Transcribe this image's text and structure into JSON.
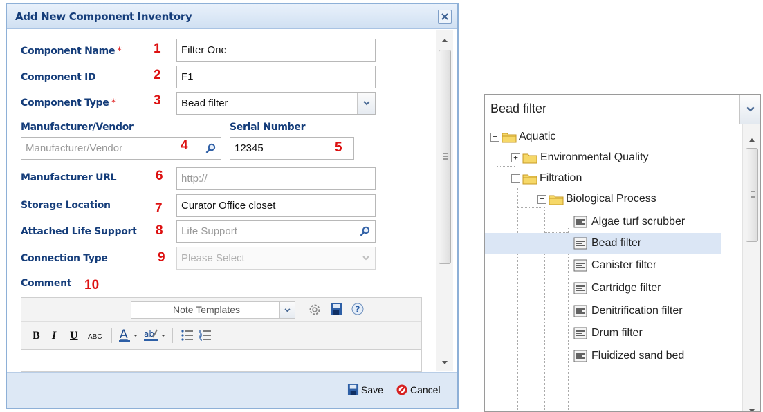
{
  "dialog": {
    "title": "Add New Component Inventory",
    "save_label": "Save",
    "cancel_label": "Cancel"
  },
  "form": {
    "component_name": {
      "label": "Component Name",
      "required_mark": "*",
      "value": "Filter One",
      "number": "1"
    },
    "component_id": {
      "label": "Component ID",
      "value": "F1",
      "number": "2"
    },
    "component_type": {
      "label": "Component Type",
      "required_mark": "*",
      "value": "Bead filter",
      "number": "3"
    },
    "manufacturer": {
      "label": "Manufacturer/Vendor",
      "placeholder": "Manufacturer/Vendor",
      "number": "4"
    },
    "serial_number": {
      "label": "Serial Number",
      "value": "12345",
      "number": "5"
    },
    "manufacturer_url": {
      "label": "Manufacturer URL",
      "placeholder": "http://",
      "number": "6"
    },
    "storage_location": {
      "label": "Storage Location",
      "value": "Curator Office closet",
      "number": "7"
    },
    "life_support": {
      "label": "Attached Life Support",
      "placeholder": "Life Support",
      "number": "8"
    },
    "connection_type": {
      "label": "Connection Type",
      "placeholder": "Please Select",
      "number": "9"
    },
    "comment": {
      "label": "Comment",
      "number": "10"
    }
  },
  "editor": {
    "note_templates": "Note Templates",
    "format_buttons": [
      "B",
      "I",
      "U",
      "ABC"
    ]
  },
  "type_panel": {
    "value": "Bead filter",
    "tree": [
      {
        "label": "Aquatic",
        "kind": "folder",
        "expander": "−",
        "level": 0
      },
      {
        "label": "Environmental Quality",
        "kind": "folder",
        "expander": "+",
        "level": 1
      },
      {
        "label": "Filtration",
        "kind": "folder",
        "expander": "−",
        "level": 1
      },
      {
        "label": "Biological Process",
        "kind": "folder",
        "expander": "−",
        "level": 2
      },
      {
        "label": "Algae turf scrubber",
        "kind": "leaf",
        "level": 3
      },
      {
        "label": "Bead filter",
        "kind": "leaf",
        "level": 3,
        "selected": true
      },
      {
        "label": "Canister filter",
        "kind": "leaf",
        "level": 3
      },
      {
        "label": "Cartridge filter",
        "kind": "leaf",
        "level": 3
      },
      {
        "label": "Denitrification filter",
        "kind": "leaf",
        "level": 3
      },
      {
        "label": "Drum filter",
        "kind": "leaf",
        "level": 3
      },
      {
        "label": "Fluidized sand bed",
        "kind": "leaf",
        "level": 3
      }
    ]
  },
  "colors": {
    "label_blue": "#153d7a",
    "number_red": "#dd1111",
    "selection": "#dbe6f5"
  }
}
